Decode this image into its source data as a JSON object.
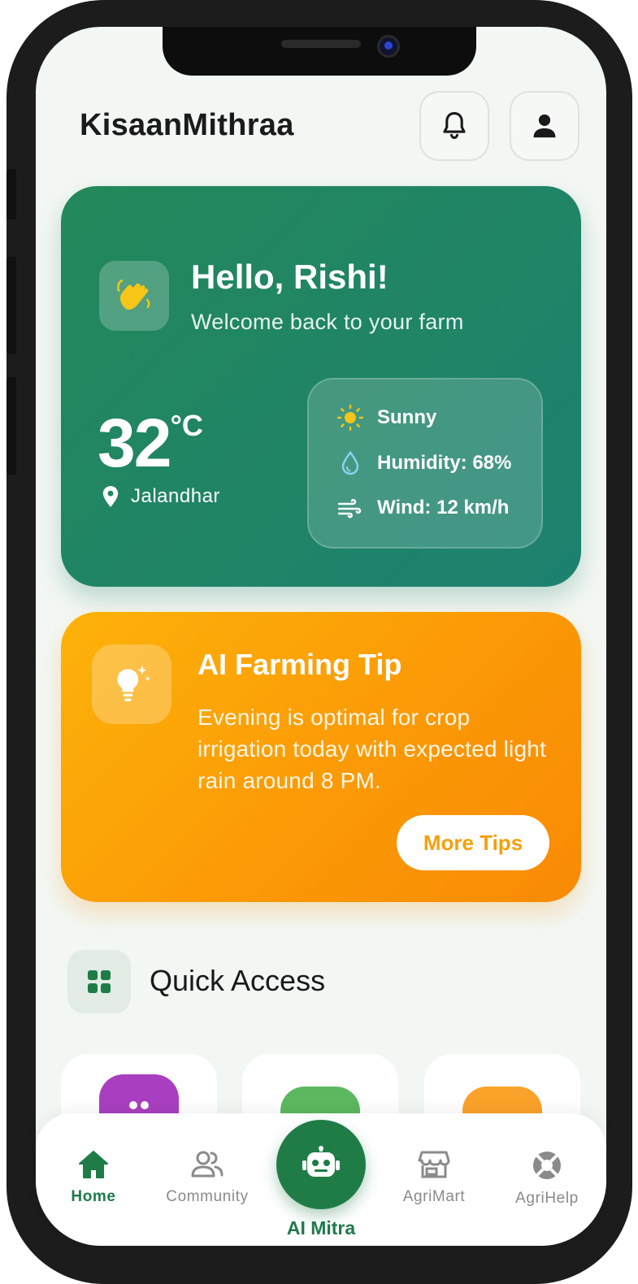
{
  "header": {
    "app_title": "KisaanMithraa",
    "notification_icon": "bell-icon",
    "profile_icon": "user-icon"
  },
  "weather_card": {
    "greeting": "Hello, Rishi!",
    "subtitle": "Welcome back to your farm",
    "temperature": "32",
    "unit": "°C",
    "location": "Jalandhar",
    "condition": "Sunny",
    "humidity": "Humidity: 68%",
    "wind": "Wind: 12 km/h"
  },
  "tip_card": {
    "title": "AI Farming Tip",
    "text": "Evening is optimal for crop irrigation today with expected light rain around 8 PM.",
    "button_label": "More Tips"
  },
  "quick_access": {
    "title": "Quick Access",
    "tiles": [
      {
        "color": "#a93fc0"
      },
      {
        "color": "#5cb85f"
      },
      {
        "color": "#fba22a"
      }
    ]
  },
  "bottom_nav": {
    "items": [
      {
        "label": "Home",
        "icon": "home-icon",
        "active": true
      },
      {
        "label": "Community",
        "icon": "people-icon",
        "active": false
      },
      {
        "label": "AI Mitra",
        "icon": "robot-icon",
        "active": false
      },
      {
        "label": "AgriMart",
        "icon": "store-icon",
        "active": false
      },
      {
        "label": "AgriHelp",
        "icon": "lifebuoy-icon",
        "active": false
      }
    ]
  },
  "colors": {
    "brand_green": "#1f7c47",
    "tip_orange": "#fb9a06",
    "accent_yellow": "#f5c518"
  }
}
